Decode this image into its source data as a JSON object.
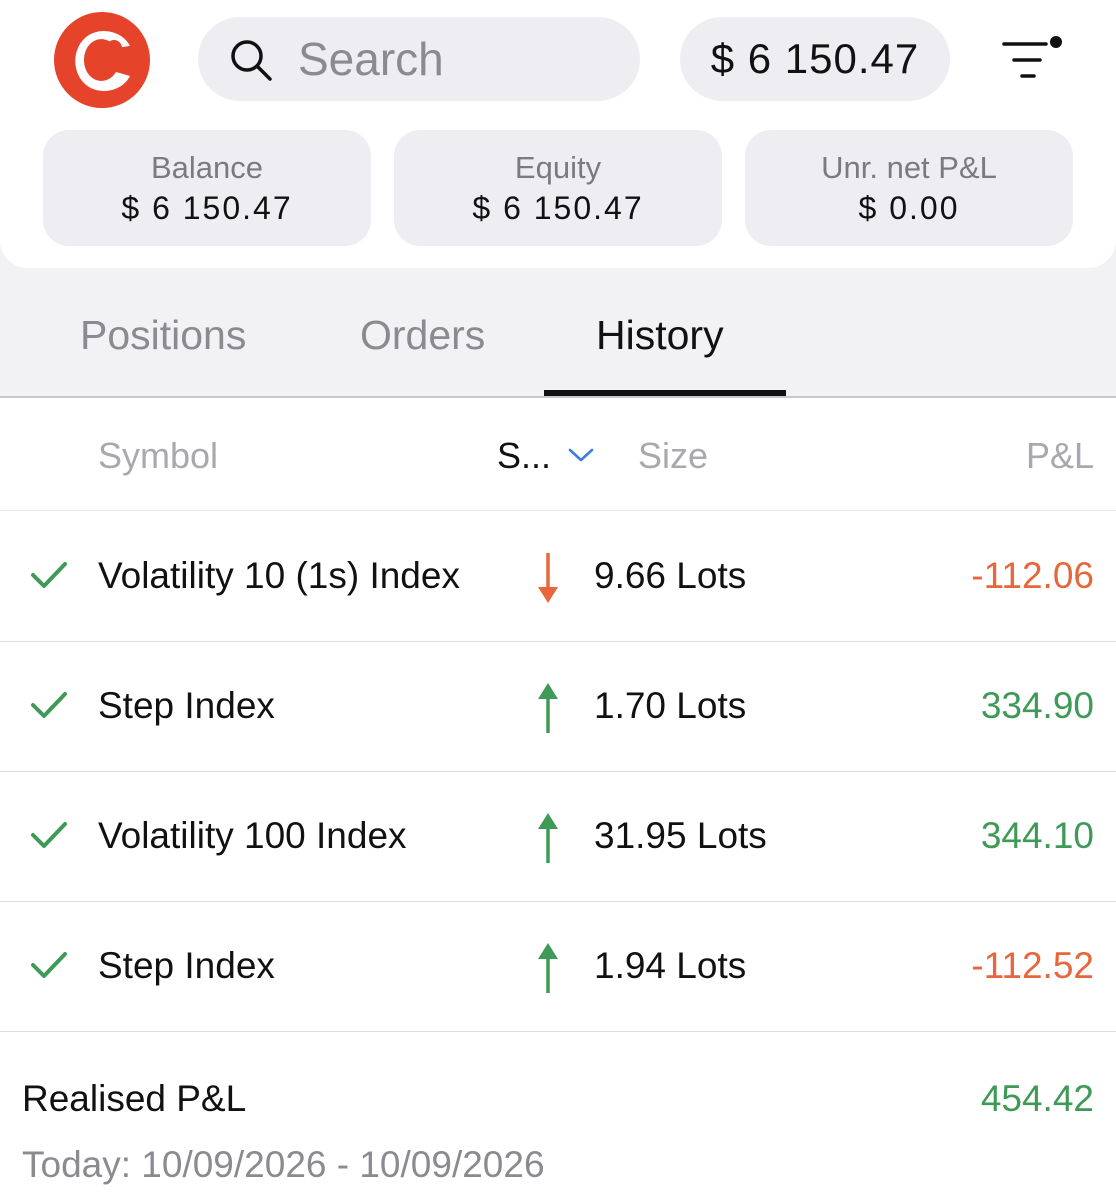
{
  "header": {
    "search_placeholder": "Search",
    "account_balance": "$ 6 150.47"
  },
  "stats": [
    {
      "label": "Balance",
      "value": "$ 6 150.47"
    },
    {
      "label": "Equity",
      "value": "$ 6 150.47"
    },
    {
      "label": "Unr. net P&L",
      "value": "$ 0.00"
    }
  ],
  "tabs": [
    {
      "label": "Positions",
      "active": false
    },
    {
      "label": "Orders",
      "active": false
    },
    {
      "label": "History",
      "active": true
    }
  ],
  "columns": {
    "symbol": "Symbol",
    "side": "S...",
    "size": "Size",
    "pnl": "P&L"
  },
  "rows": [
    {
      "symbol": "Volatility 10 (1s) Index",
      "direction": "down",
      "size": "9.66 Lots",
      "pnl": "-112.06"
    },
    {
      "symbol": "Step Index",
      "direction": "up",
      "size": "1.70 Lots",
      "pnl": "334.90"
    },
    {
      "symbol": "Volatility 100 Index",
      "direction": "up",
      "size": "31.95 Lots",
      "pnl": "344.10"
    },
    {
      "symbol": "Step Index",
      "direction": "up",
      "size": "1.94 Lots",
      "pnl": "-112.52"
    }
  ],
  "footer": {
    "label": "Realised P&L",
    "value": "454.42",
    "date_range": "Today: 10/09/2026 - 10/09/2026"
  },
  "colors": {
    "brand": "#e5432a",
    "positive": "#3e9a56",
    "negative": "#e8663c"
  }
}
